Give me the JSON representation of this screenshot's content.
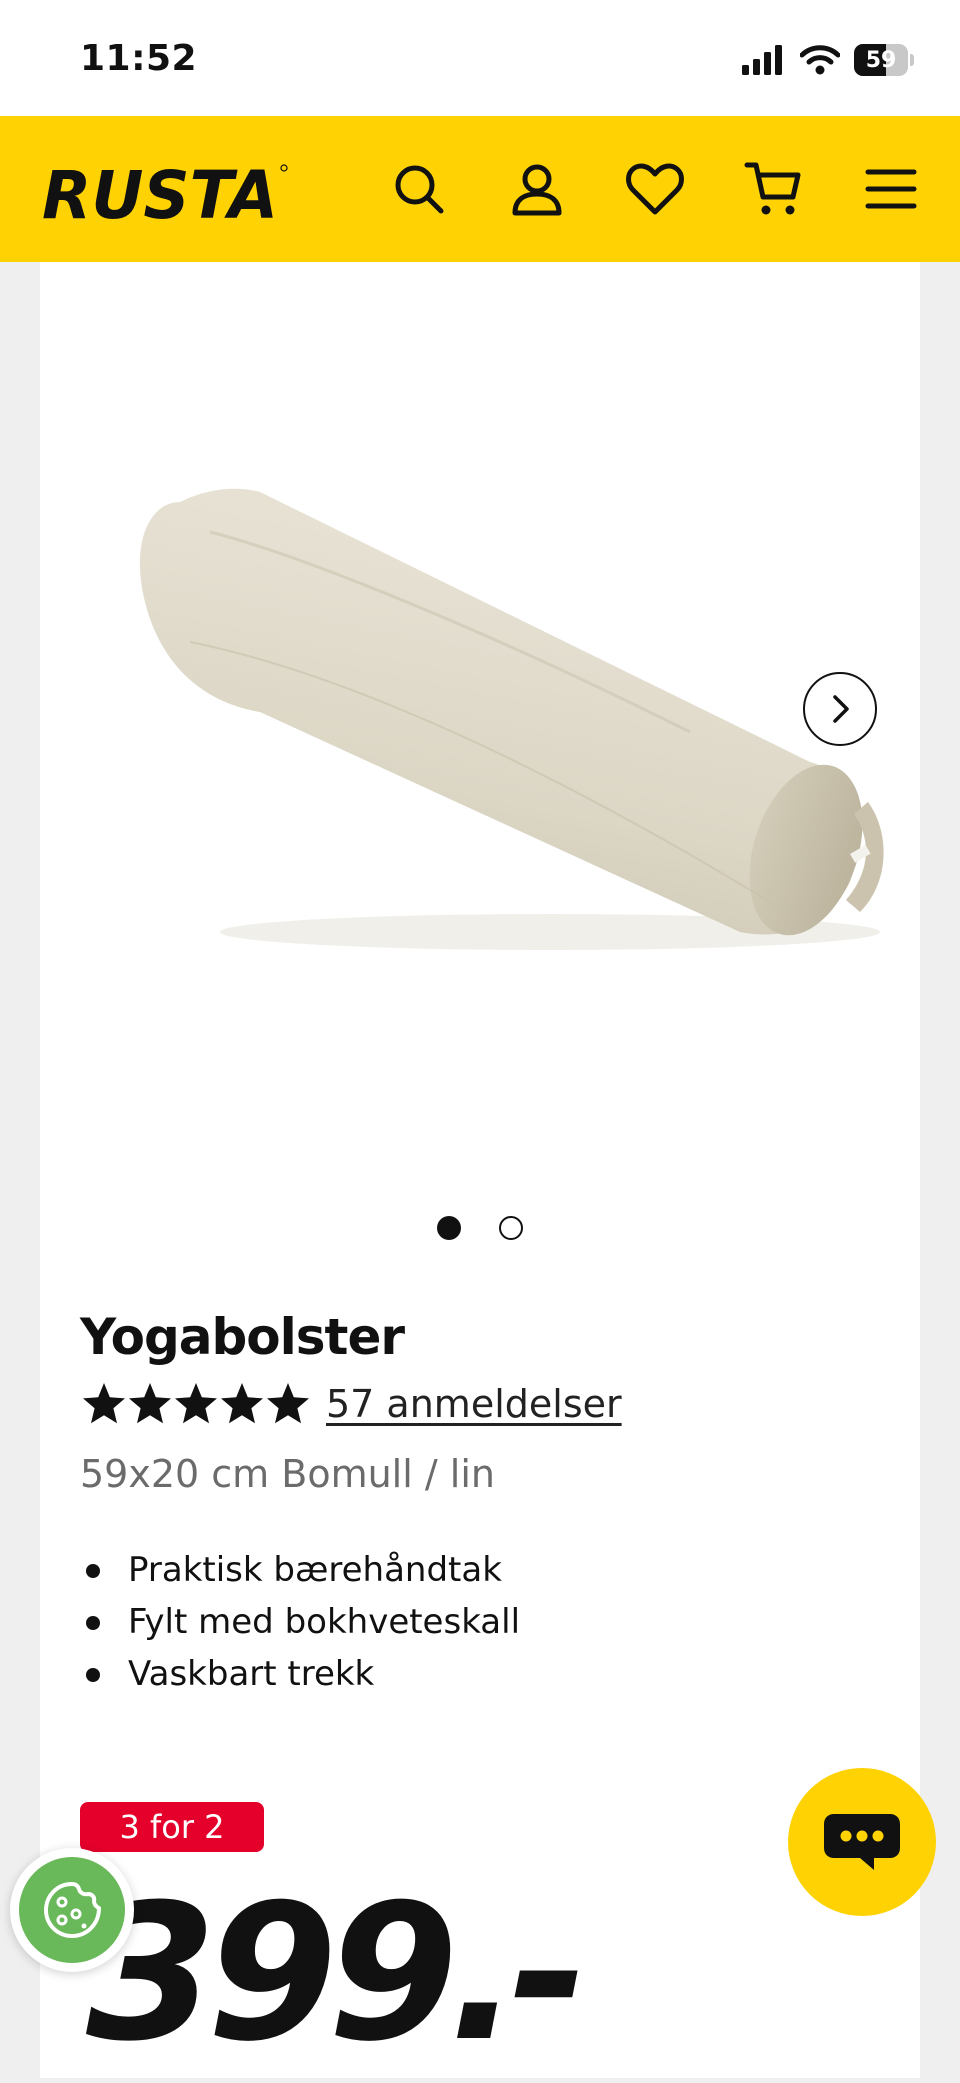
{
  "status_bar": {
    "time": "11:52",
    "battery": "59",
    "battery_level": 0.59
  },
  "header": {
    "logo_text": "RUSTA",
    "icons": [
      "search-icon",
      "account-icon",
      "wishlist-heart-icon",
      "cart-icon",
      "menu-icon"
    ]
  },
  "gallery": {
    "slide_count": 2,
    "active_slide": 1
  },
  "product": {
    "title": "Yogabolster",
    "rating": 5,
    "max_rating": 5,
    "reviews": "57 anmeldelser",
    "subtitle": "59x20 cm Bomull / lin",
    "features": [
      "Praktisk bærehåndtak",
      "Fylt med bokhveteskall",
      "Vaskbart trekk"
    ],
    "promo": "3 for 2",
    "price": "399.-"
  },
  "colors": {
    "brand_yellow": "#fed203",
    "promo_red": "#e4002b",
    "cookie_green": "#69b85a"
  }
}
